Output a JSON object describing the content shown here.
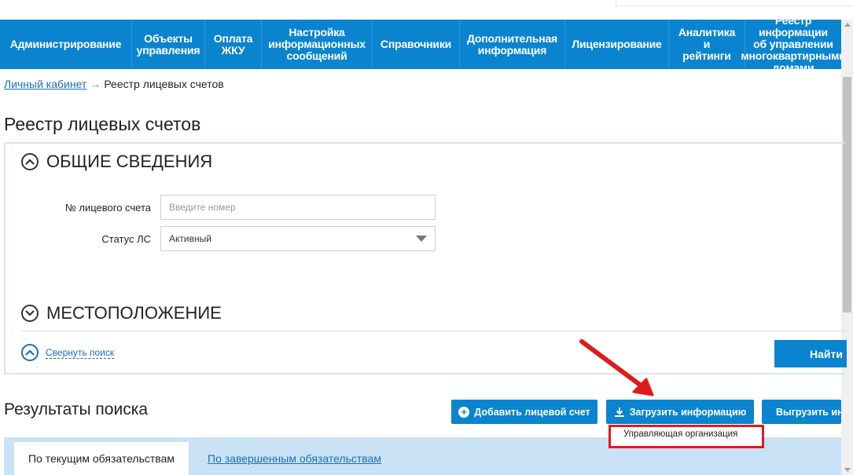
{
  "nav": {
    "items": [
      {
        "label": "Администрирование",
        "w": 168
      },
      {
        "label": "Объекты\nуправления",
        "w": 93
      },
      {
        "label": "Оплата\nЖКУ",
        "w": 72
      },
      {
        "label": "Настройка\nинформационных\nсообщений",
        "w": 141
      },
      {
        "label": "Справочники",
        "w": 111
      },
      {
        "label": "Дополнительная\nинформация",
        "w": 134
      },
      {
        "label": "Лицензирование",
        "w": 132
      },
      {
        "label": "Аналитика и\nрейтинги",
        "w": 97
      },
      {
        "label": "Реестр информации\nоб управлении\nмногоквартирными\nдомами",
        "w": 122
      }
    ]
  },
  "breadcrumb": {
    "home": "Личный кабинет",
    "sep": "→",
    "current": "Реестр лицевых счетов"
  },
  "page": {
    "title": "Реестр лицевых счетов"
  },
  "filters": {
    "general_title": "ОБЩИЕ СВЕДЕНИЯ",
    "account_label": "№ лицевого счета",
    "account_placeholder": "Введите номер",
    "status_label": "Статус ЛС",
    "status_value": "Активный",
    "location_title": "МЕСТОПОЛОЖЕНИЕ",
    "collapse_label": "Свернуть поиск",
    "find_label": "Найти"
  },
  "results": {
    "title": "Результаты поиска",
    "add_label": "Добавить лицевой счет",
    "upload_label": "Загрузить информацию",
    "export_label": "Выгрузить информацию",
    "dropdown_item": "Управляющая организация"
  },
  "tabs": {
    "current": "По текущим обязательствам",
    "completed": "По завершенным обязательствам"
  },
  "colors": {
    "accent": "#0b84d0",
    "link": "#1a6fb8",
    "highlight": "#e01b1b",
    "tabs_bg": "#c9e2f5"
  }
}
